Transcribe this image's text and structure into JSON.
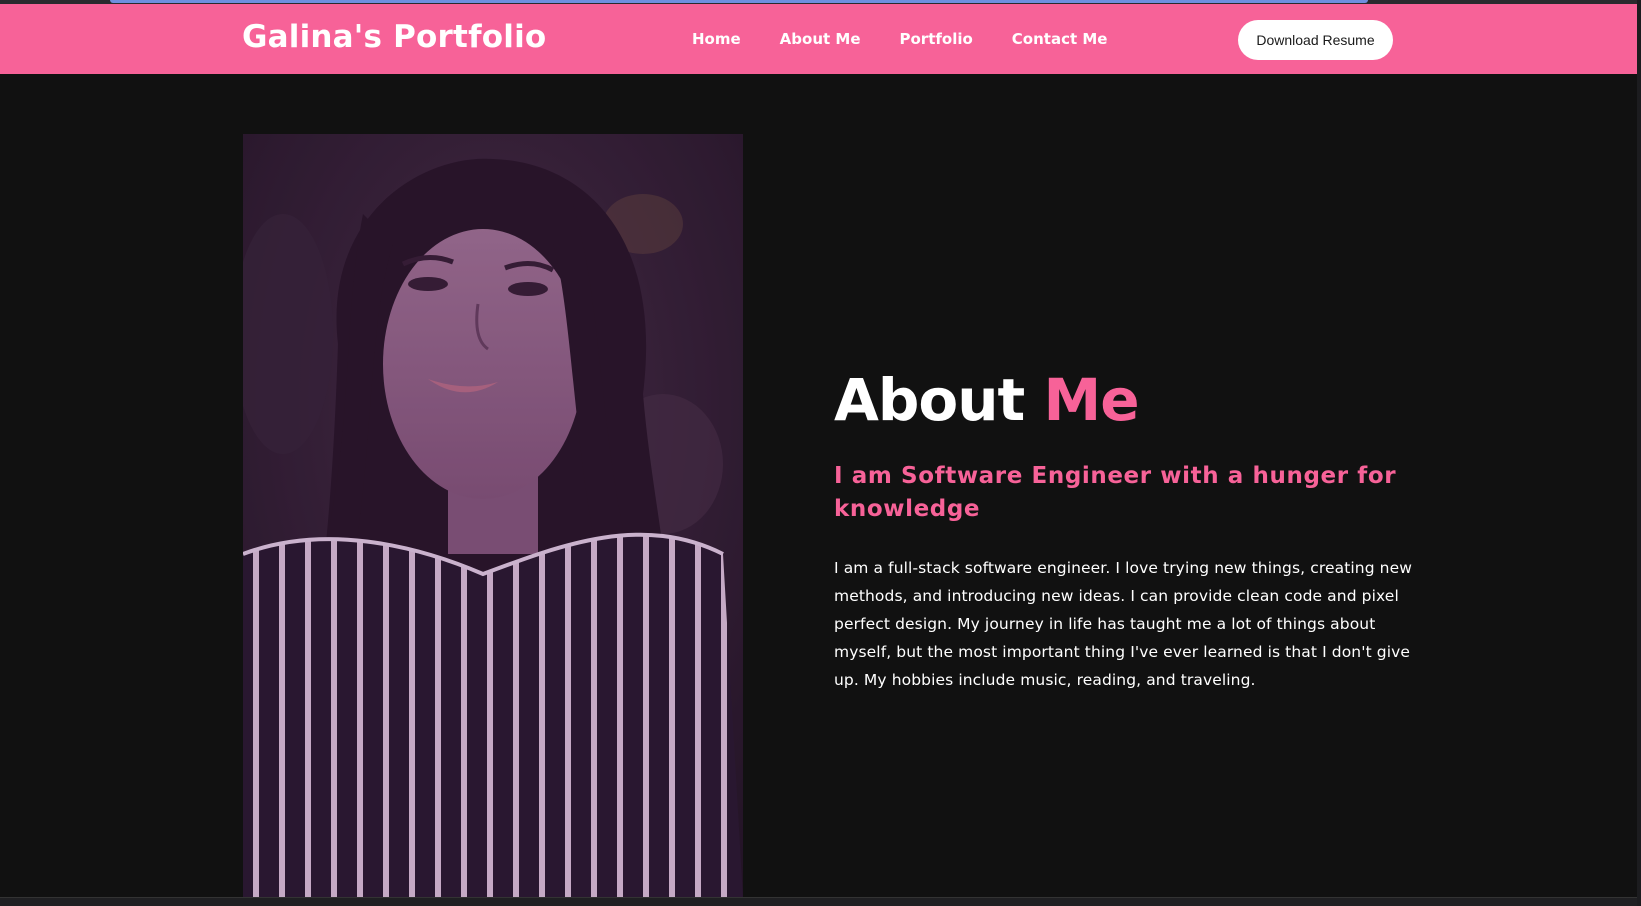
{
  "nav": {
    "brand": "Galina's Portfolio",
    "links": [
      "Home",
      "About Me",
      "Portfolio",
      "Contact Me"
    ],
    "cta_label": "Download Resume"
  },
  "about": {
    "heading_main": "About",
    "heading_accent": "Me",
    "subheading": "I am Software Engineer with a hunger for knowledge",
    "body": "I am a full-stack software engineer. I love trying new things, creating new methods, and introducing new ideas. I can provide clean code and pixel perfect design. My journey in life has taught me a lot of things about myself, but the most important thing I've ever learned is that I don't give up. My hobbies include music, reading, and traveling."
  },
  "colors": {
    "accent": "#f76298",
    "background": "#111111",
    "text": "#ffffff"
  }
}
